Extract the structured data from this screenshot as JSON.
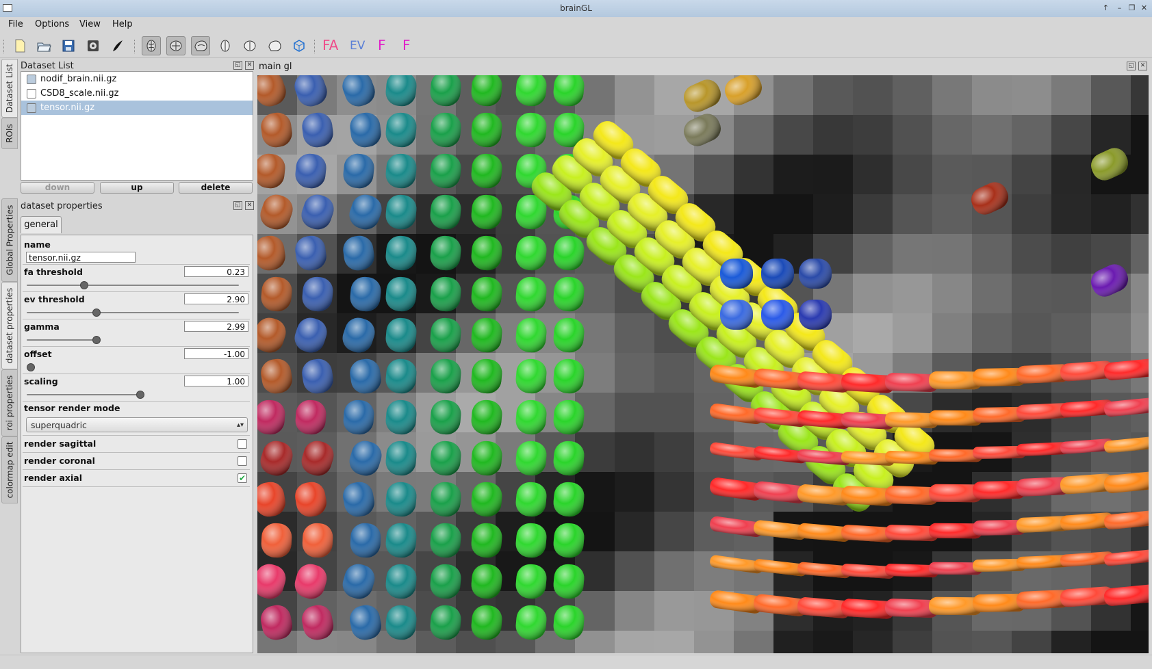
{
  "window": {
    "title": "brainGL"
  },
  "menu": [
    "File",
    "Options",
    "View",
    "Help"
  ],
  "toolbar": {
    "text_buttons": [
      {
        "label": "FA",
        "color": "#ef4b8a"
      },
      {
        "label": "EV",
        "color": "#5a7fd6"
      },
      {
        "label": "F",
        "color": "#e020c8"
      },
      {
        "label": "F",
        "color": "#e020c8"
      }
    ]
  },
  "side_tabs_top": [
    "Dataset List",
    "ROIs"
  ],
  "side_tabs_bottom": [
    "Global Properties",
    "dataset properties",
    "roi properties",
    "colormap edit"
  ],
  "dataset_list": {
    "title": "Dataset List",
    "items": [
      {
        "label": "nodif_brain.nii.gz",
        "selected": false
      },
      {
        "label": "CSD8_scale.nii.gz",
        "selected": false
      },
      {
        "label": "tensor.nii.gz",
        "selected": true
      }
    ],
    "buttons": {
      "down": "down",
      "up": "up",
      "delete": "delete"
    }
  },
  "dataset_properties": {
    "title": "dataset properties",
    "tab": "general",
    "name_label": "name",
    "name_value": "tensor.nii.gz",
    "sliders": [
      {
        "label": "fa threshold",
        "value": "0.23",
        "level": 0.27
      },
      {
        "label": "ev threshold",
        "value": "2.90",
        "level": 0.33
      },
      {
        "label": "gamma",
        "value": "2.99",
        "level": 0.34
      },
      {
        "label": "offset",
        "value": "-1.00",
        "level": 0.0
      },
      {
        "label": "scaling",
        "value": "1.00",
        "level": 0.5
      }
    ],
    "render_mode_label": "tensor render mode",
    "render_mode_value": "superquadric",
    "checks": [
      {
        "label": "render sagittal",
        "checked": false
      },
      {
        "label": "render coronal",
        "checked": false
      },
      {
        "label": "render axial",
        "checked": true
      }
    ]
  },
  "gl_view": {
    "title": "main gl"
  }
}
